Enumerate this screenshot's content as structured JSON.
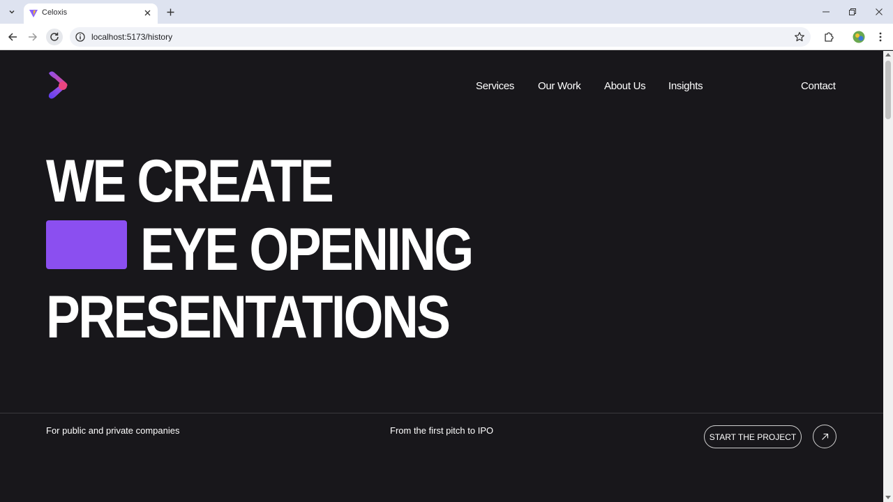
{
  "browser": {
    "tab_title": "Celoxis",
    "url": "localhost:5173/history"
  },
  "nav": {
    "services": "Services",
    "our_work": "Our Work",
    "about_us": "About Us",
    "insights": "Insights",
    "contact": "Contact"
  },
  "hero": {
    "line1": "WE CREATE",
    "line2": "EYE OPENING",
    "line3": "PRESENTATIONS"
  },
  "footer_strip": {
    "tagline_left": "For public and private companies",
    "tagline_middle": "From the first pitch to IPO",
    "cta_label": "START THE PROJECT"
  },
  "colors": {
    "accent": "#8b4ff0",
    "background": "#18171b",
    "logo_pink": "#e9457f"
  },
  "icons": {
    "tab_menu": "chevron-down-icon",
    "favicon": "vite-logo-icon",
    "tab_close": "close-icon",
    "new_tab": "plus-icon",
    "back": "arrow-left-icon",
    "forward": "arrow-right-icon",
    "reload": "reload-icon",
    "site_info": "info-icon",
    "bookmark": "star-icon",
    "extensions": "puzzle-icon",
    "profile": "avatar-icon",
    "menu": "kebab-icon",
    "cta": "arrow-up-right-icon"
  }
}
